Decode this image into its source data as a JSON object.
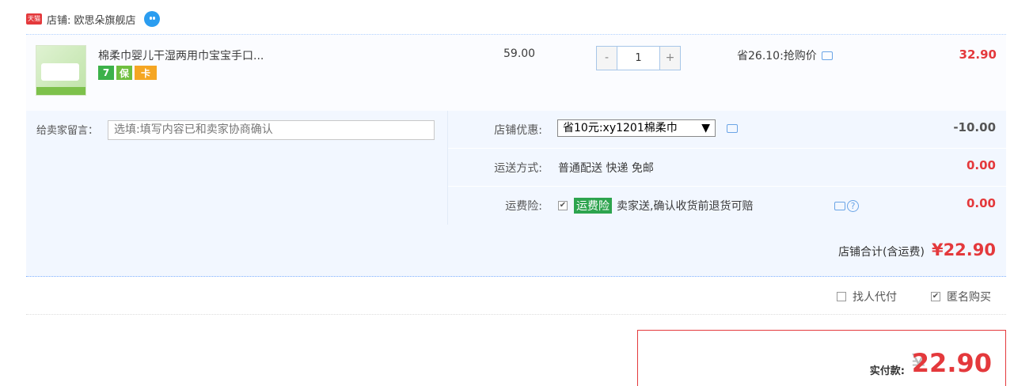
{
  "store": {
    "tmall_badge": "天猫",
    "label": "店铺: 欧思朵旗舰店"
  },
  "item": {
    "title": "棉柔巾婴儿干湿两用巾宝宝手口...",
    "badges": [
      "7",
      "保",
      "卡"
    ],
    "unit_price": "59.00",
    "quantity": {
      "minus": "-",
      "value": "1",
      "plus": "+"
    },
    "promo": "省26.10:抢购价",
    "subtotal": "32.90"
  },
  "message": {
    "label": "给卖家留言：",
    "placeholder": "选填:填写内容已和卖家协商确认"
  },
  "options": {
    "discount": {
      "label": "店铺优惠:",
      "selected": "省10元:xy1201棉柔巾",
      "arrow": "▼",
      "amount": "-10.00"
    },
    "shipping": {
      "label": "运送方式:",
      "value": "普通配送 快递 免邮",
      "amount": "0.00"
    },
    "insurance": {
      "label": "运费险:",
      "tag": "运费险",
      "text": "卖家送,确认收货前退货可赔",
      "help": "?",
      "amount": "0.00"
    }
  },
  "store_total": {
    "label": "店铺合计(含运费)",
    "value": "¥22.90"
  },
  "checkboxes": [
    {
      "label": "找人代付",
      "checked": false
    },
    {
      "label": "匿名购买",
      "checked": true
    }
  ],
  "payment": {
    "label": "实付款:",
    "currency": "¥",
    "value": "22.90"
  },
  "colors": {
    "accent_red": "#e4393c",
    "row_bg": "#f2f7ff",
    "link_blue": "#6aa4e6"
  }
}
